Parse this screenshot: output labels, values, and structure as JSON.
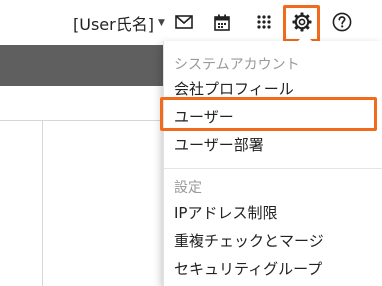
{
  "header": {
    "user_name": "[User氏名]",
    "icons": {
      "mail": "mail-icon",
      "calendar": "calendar-icon",
      "apps": "apps-grid-icon",
      "settings": "gear-icon",
      "help": "help-icon"
    }
  },
  "menu": {
    "system_account_label": "システムアカウント",
    "company_profile": "会社プロフィール",
    "user": "ユーザー",
    "user_department": "ユーザー部署",
    "settings_label": "設定",
    "ip_restriction": "IPアドレス制限",
    "duplicate_merge": "重複チェックとマージ",
    "security_group": "セキュリティグループ"
  },
  "colors": {
    "highlight": "#f26a1b",
    "band": "#5f5f5f"
  }
}
